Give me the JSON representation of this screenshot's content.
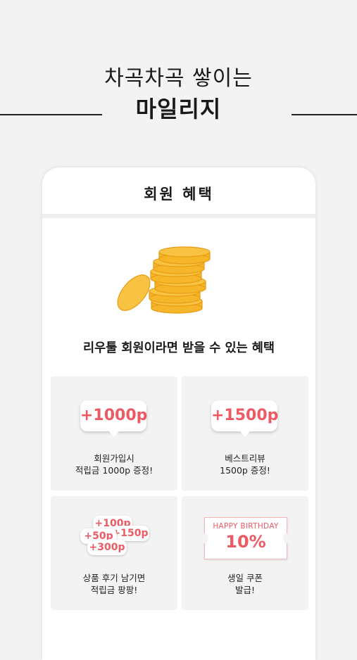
{
  "hero": {
    "line1": "차곡차곡 쌓이는",
    "line2": "마일리지"
  },
  "panel": {
    "title": "회원 혜택",
    "headline": "리우툴 회원이라면 받을 수 있는 혜택"
  },
  "benefits": [
    {
      "badge": "+1000p",
      "line1": "회원가입시",
      "line2": "적립금 1000p 증정!"
    },
    {
      "badge": "+1500p",
      "line1": "베스트리뷰",
      "line2": "1500p 증정!"
    },
    {
      "badges": [
        "+100p",
        "+50p",
        "+150p",
        "+300p"
      ],
      "line1": "상품 후기 남기면",
      "line2": "적립금 팡팡!"
    },
    {
      "ticket_top": "HAPPY BIRTHDAY",
      "ticket_value": "10%",
      "line1": "생일 쿠폰",
      "line2": "발급!"
    }
  ],
  "colors": {
    "accent": "#ec5a63",
    "coin": "#f5b62a"
  }
}
